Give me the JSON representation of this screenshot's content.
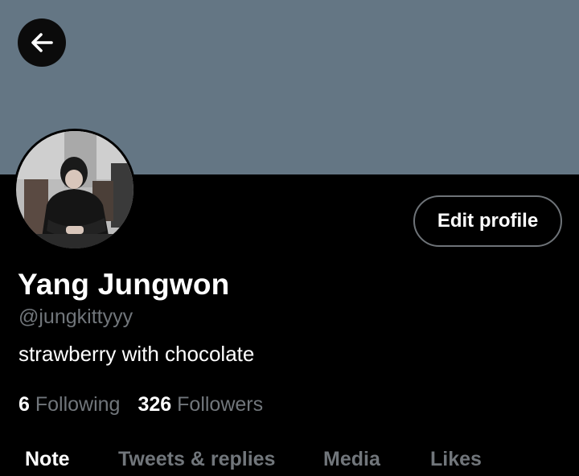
{
  "colors": {
    "banner": "#647684",
    "background": "#000000",
    "text_primary": "#ffffff",
    "text_secondary": "#71767b",
    "button_border": "#6e7378"
  },
  "header": {
    "back_icon": "arrow-left-icon"
  },
  "profile": {
    "avatar_icon": "profile-photo",
    "edit_label": "Edit profile",
    "name": "Yang Jungwon",
    "handle": "@jungkittyyy",
    "bio": "strawberry with chocolate"
  },
  "stats": {
    "following_count": "6",
    "following_label": "Following",
    "followers_count": "326",
    "followers_label": "Followers"
  },
  "tabs": [
    {
      "label": "Note",
      "active": true
    },
    {
      "label": "Tweets & replies",
      "active": false
    },
    {
      "label": "Media",
      "active": false
    },
    {
      "label": "Likes",
      "active": false
    }
  ]
}
